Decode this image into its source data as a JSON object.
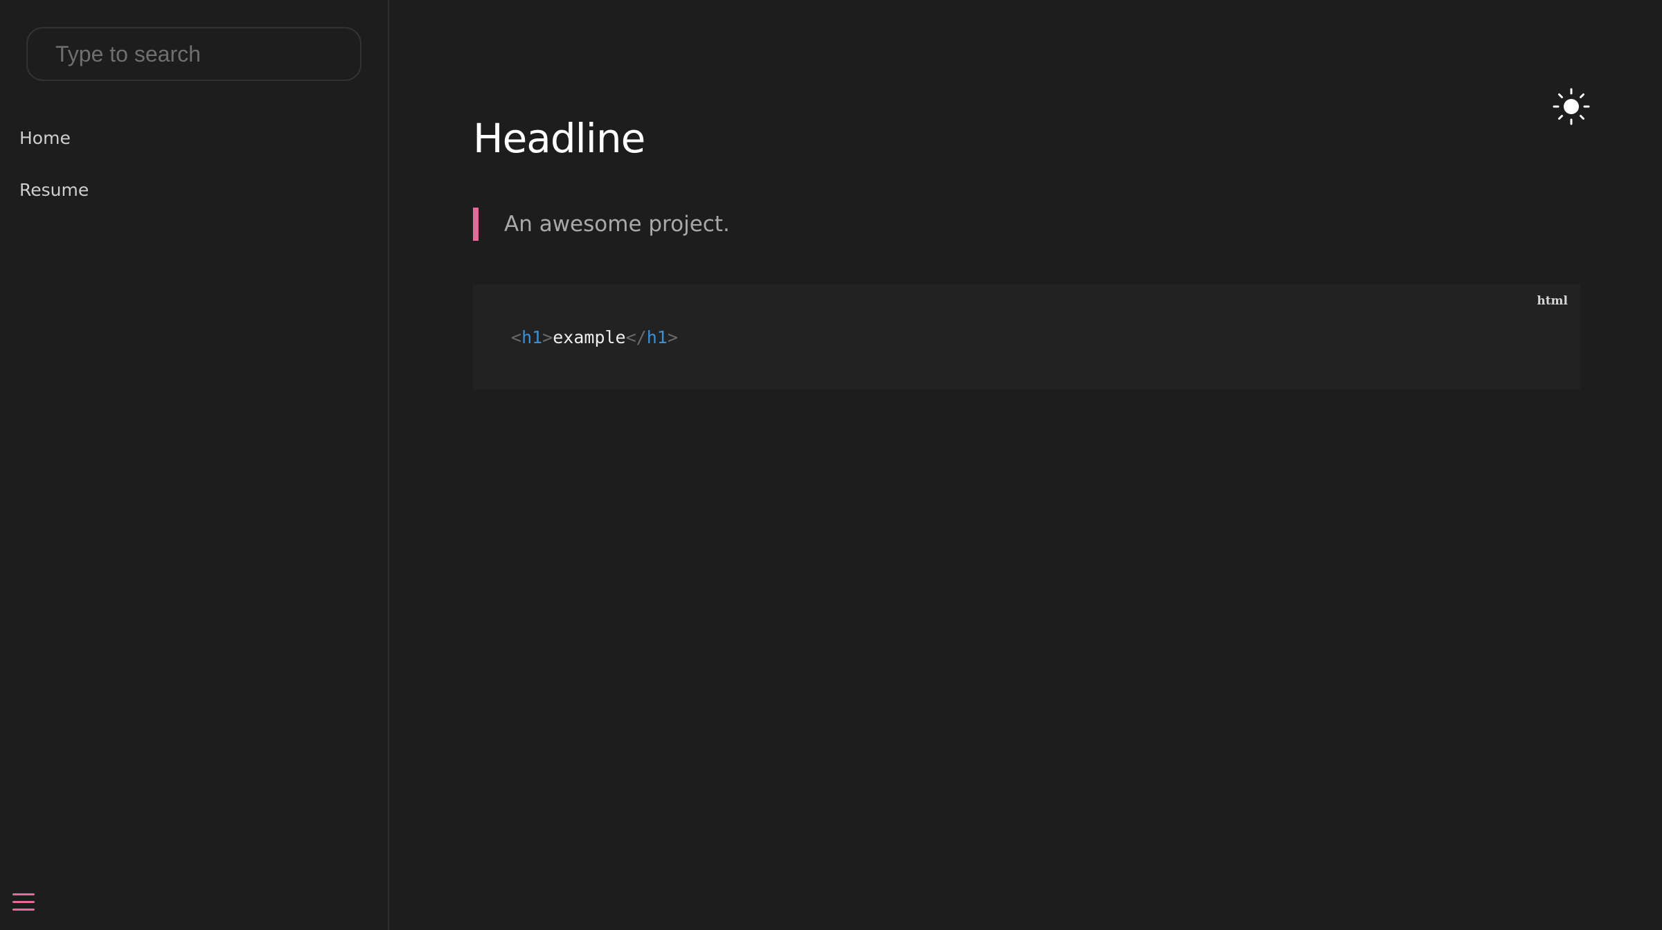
{
  "sidebar": {
    "search": {
      "placeholder": "Type to search",
      "value": ""
    },
    "nav": [
      {
        "label": "Home"
      },
      {
        "label": "Resume"
      }
    ],
    "menu_icon": "hamburger-icon"
  },
  "main": {
    "theme_icon": "sun-icon",
    "headline": "Headline",
    "blockquote": "An awesome project.",
    "code": {
      "language": "html",
      "tokens": {
        "open_lt": "<",
        "open_tag": "h1",
        "open_gt": ">",
        "text": "example",
        "close_lt": "</",
        "close_tag": "h1",
        "close_gt": ">"
      }
    }
  },
  "colors": {
    "background": "#1d1d1d",
    "accent": "#e8689a",
    "code_background": "#222222",
    "code_tag": "#3d8fd1"
  }
}
